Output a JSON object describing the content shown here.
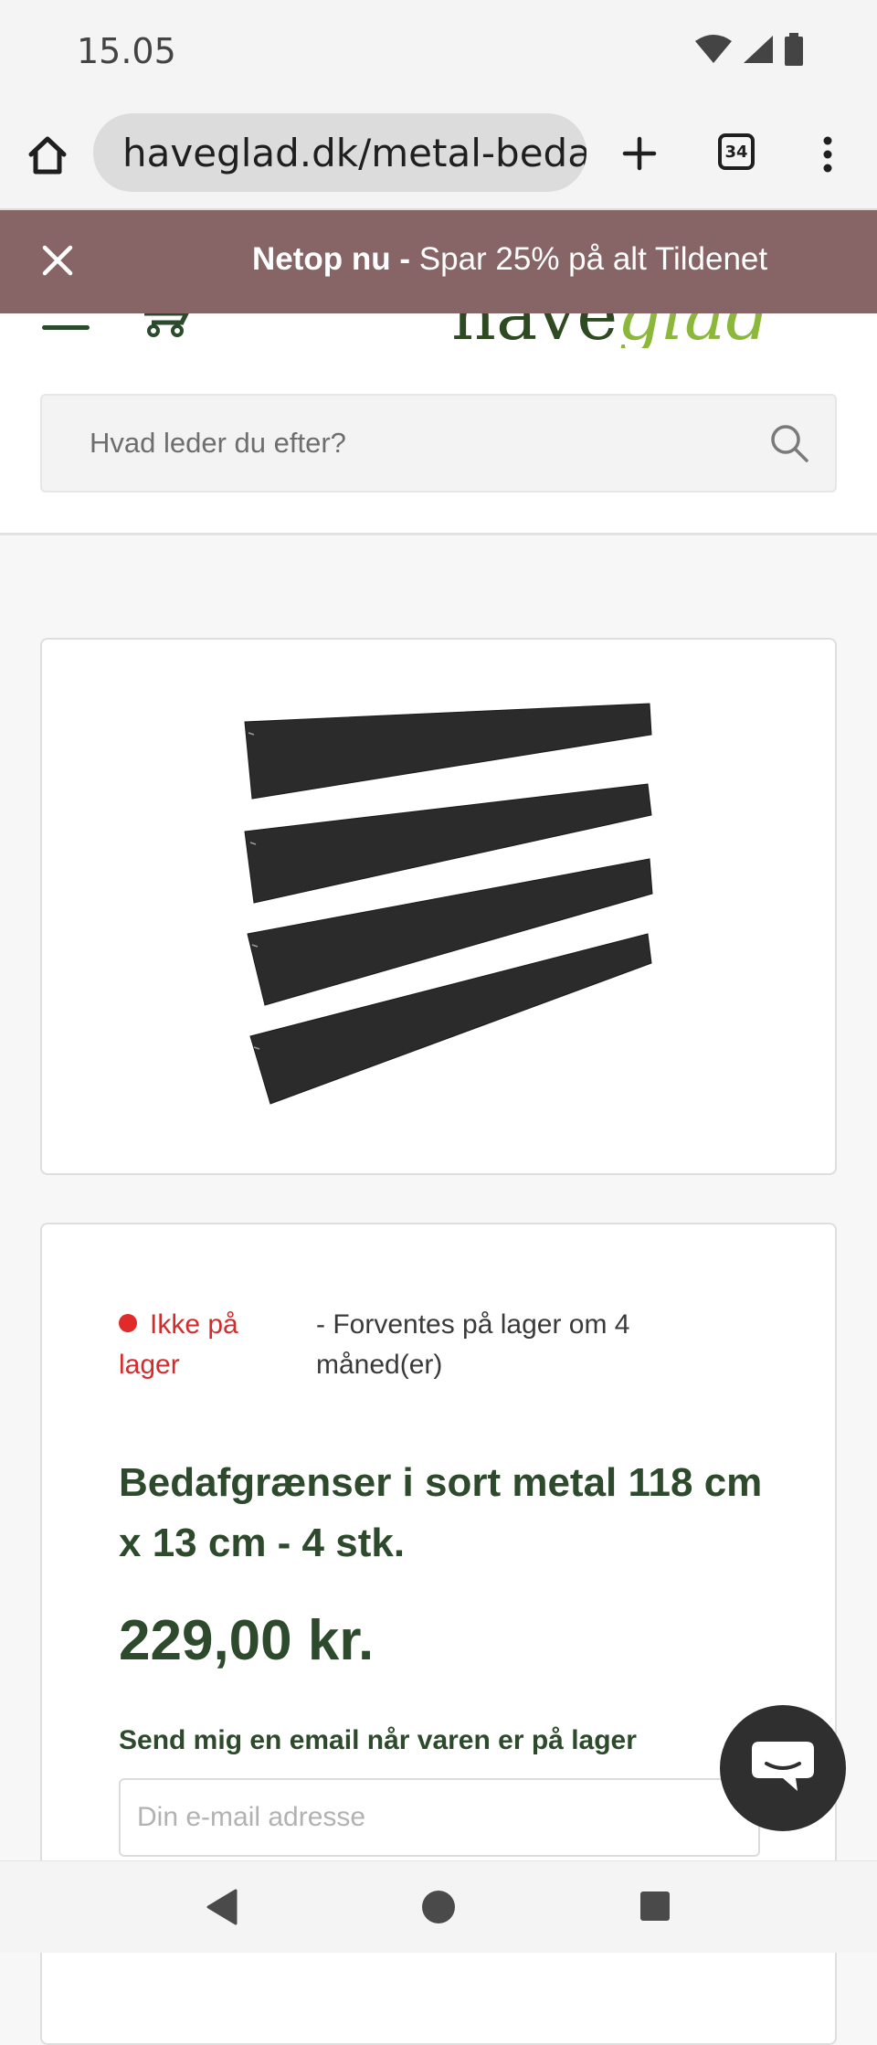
{
  "status_bar": {
    "time": "15.05"
  },
  "browser": {
    "url": "haveglad.dk/metal-beda",
    "tab_count": "34"
  },
  "promo": {
    "bold": "Netop nu -",
    "text": " Spar 25% på alt Tildenet"
  },
  "header": {
    "logo_part1": "have",
    "logo_part2": "glad"
  },
  "search": {
    "placeholder": "Hvad leder du efter?"
  },
  "product": {
    "stock_status": "Ikke på lager",
    "stock_eta": "- Forventes på lager om 4 måned(er)",
    "title": "Bedafgrænser i sort metal 118 cm x 13 cm - 4 stk.",
    "price": "229,00 kr.",
    "notify_label": "Send mig en email når varen er på lager",
    "email_placeholder": "Din e-mail adresse"
  },
  "colors": {
    "promo_bg": "#876566",
    "brand_green": "#2e4a2c",
    "stock_red": "#e12b2b"
  }
}
